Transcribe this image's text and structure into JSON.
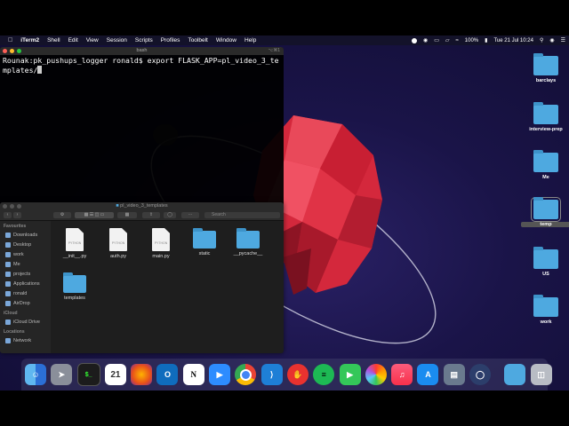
{
  "menubar": {
    "app_name": "iTerm2",
    "items": [
      "Shell",
      "Edit",
      "View",
      "Session",
      "Scripts",
      "Profiles",
      "Toolbelt",
      "Window",
      "Help"
    ],
    "battery": "100%",
    "datetime": "Tue 21 Jul  10:24"
  },
  "terminal": {
    "title": "bash",
    "shortcut": "⌥⌘1",
    "prompt": "Rounak:pk_pushups_logger ronald$ ",
    "command": "export FLASK_APP=pl_video_3_templates/"
  },
  "finder": {
    "title": "pl_video_3_templates",
    "search_placeholder": "Search",
    "favorites_heading": "Favourites",
    "favorites": [
      "Downloads",
      "Desktop",
      "work",
      "Me",
      "projects",
      "Applications",
      "ronald",
      "AirDrop"
    ],
    "icloud_heading": "iCloud",
    "icloud": [
      "iCloud Drive"
    ],
    "locations_heading": "Locations",
    "locations": [
      "Network"
    ],
    "files": [
      {
        "name": "__init__.py",
        "kind": "python",
        "badge": "PYTHON"
      },
      {
        "name": "auth.py",
        "kind": "python",
        "badge": "PYTHON"
      },
      {
        "name": "main.py",
        "kind": "python",
        "badge": "PYTHON"
      },
      {
        "name": "static",
        "kind": "folder"
      },
      {
        "name": "__pycache__",
        "kind": "folder"
      },
      {
        "name": "templates",
        "kind": "folder"
      }
    ]
  },
  "desktop_icons": [
    "barclays",
    "interview-prep",
    "Me",
    "temp",
    "US",
    "work"
  ],
  "dock_apps": [
    "finder-icon",
    "launchpad-icon",
    "terminal-icon",
    "calendar-icon",
    "firefox-icon",
    "outlook-icon",
    "notion-icon",
    "zoom-icon",
    "chrome-icon",
    "vscode-icon",
    "hand-icon",
    "spotify-icon",
    "facetime-icon",
    "photos-icon",
    "music-icon",
    "appstore-icon",
    "preview-icon",
    "browser-icon",
    "downloads-folder-icon",
    "trash-icon"
  ],
  "calendar_day": "21",
  "colors": {
    "accent": "#4ea9e0",
    "planet": "#d4283c"
  }
}
